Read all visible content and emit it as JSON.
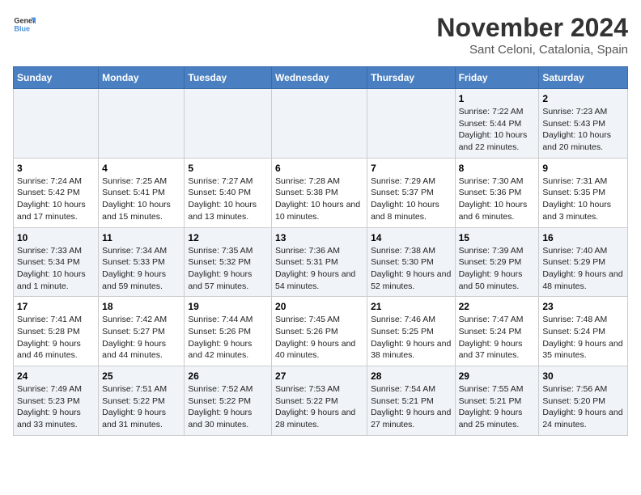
{
  "logo": {
    "general": "General",
    "blue": "Blue"
  },
  "title": "November 2024",
  "subtitle": "Sant Celoni, Catalonia, Spain",
  "headers": [
    "Sunday",
    "Monday",
    "Tuesday",
    "Wednesday",
    "Thursday",
    "Friday",
    "Saturday"
  ],
  "rows": [
    [
      {
        "day": "",
        "info": ""
      },
      {
        "day": "",
        "info": ""
      },
      {
        "day": "",
        "info": ""
      },
      {
        "day": "",
        "info": ""
      },
      {
        "day": "",
        "info": ""
      },
      {
        "day": "1",
        "info": "Sunrise: 7:22 AM\nSunset: 5:44 PM\nDaylight: 10 hours and 22 minutes."
      },
      {
        "day": "2",
        "info": "Sunrise: 7:23 AM\nSunset: 5:43 PM\nDaylight: 10 hours and 20 minutes."
      }
    ],
    [
      {
        "day": "3",
        "info": "Sunrise: 7:24 AM\nSunset: 5:42 PM\nDaylight: 10 hours and 17 minutes."
      },
      {
        "day": "4",
        "info": "Sunrise: 7:25 AM\nSunset: 5:41 PM\nDaylight: 10 hours and 15 minutes."
      },
      {
        "day": "5",
        "info": "Sunrise: 7:27 AM\nSunset: 5:40 PM\nDaylight: 10 hours and 13 minutes."
      },
      {
        "day": "6",
        "info": "Sunrise: 7:28 AM\nSunset: 5:38 PM\nDaylight: 10 hours and 10 minutes."
      },
      {
        "day": "7",
        "info": "Sunrise: 7:29 AM\nSunset: 5:37 PM\nDaylight: 10 hours and 8 minutes."
      },
      {
        "day": "8",
        "info": "Sunrise: 7:30 AM\nSunset: 5:36 PM\nDaylight: 10 hours and 6 minutes."
      },
      {
        "day": "9",
        "info": "Sunrise: 7:31 AM\nSunset: 5:35 PM\nDaylight: 10 hours and 3 minutes."
      }
    ],
    [
      {
        "day": "10",
        "info": "Sunrise: 7:33 AM\nSunset: 5:34 PM\nDaylight: 10 hours and 1 minute."
      },
      {
        "day": "11",
        "info": "Sunrise: 7:34 AM\nSunset: 5:33 PM\nDaylight: 9 hours and 59 minutes."
      },
      {
        "day": "12",
        "info": "Sunrise: 7:35 AM\nSunset: 5:32 PM\nDaylight: 9 hours and 57 minutes."
      },
      {
        "day": "13",
        "info": "Sunrise: 7:36 AM\nSunset: 5:31 PM\nDaylight: 9 hours and 54 minutes."
      },
      {
        "day": "14",
        "info": "Sunrise: 7:38 AM\nSunset: 5:30 PM\nDaylight: 9 hours and 52 minutes."
      },
      {
        "day": "15",
        "info": "Sunrise: 7:39 AM\nSunset: 5:29 PM\nDaylight: 9 hours and 50 minutes."
      },
      {
        "day": "16",
        "info": "Sunrise: 7:40 AM\nSunset: 5:29 PM\nDaylight: 9 hours and 48 minutes."
      }
    ],
    [
      {
        "day": "17",
        "info": "Sunrise: 7:41 AM\nSunset: 5:28 PM\nDaylight: 9 hours and 46 minutes."
      },
      {
        "day": "18",
        "info": "Sunrise: 7:42 AM\nSunset: 5:27 PM\nDaylight: 9 hours and 44 minutes."
      },
      {
        "day": "19",
        "info": "Sunrise: 7:44 AM\nSunset: 5:26 PM\nDaylight: 9 hours and 42 minutes."
      },
      {
        "day": "20",
        "info": "Sunrise: 7:45 AM\nSunset: 5:26 PM\nDaylight: 9 hours and 40 minutes."
      },
      {
        "day": "21",
        "info": "Sunrise: 7:46 AM\nSunset: 5:25 PM\nDaylight: 9 hours and 38 minutes."
      },
      {
        "day": "22",
        "info": "Sunrise: 7:47 AM\nSunset: 5:24 PM\nDaylight: 9 hours and 37 minutes."
      },
      {
        "day": "23",
        "info": "Sunrise: 7:48 AM\nSunset: 5:24 PM\nDaylight: 9 hours and 35 minutes."
      }
    ],
    [
      {
        "day": "24",
        "info": "Sunrise: 7:49 AM\nSunset: 5:23 PM\nDaylight: 9 hours and 33 minutes."
      },
      {
        "day": "25",
        "info": "Sunrise: 7:51 AM\nSunset: 5:22 PM\nDaylight: 9 hours and 31 minutes."
      },
      {
        "day": "26",
        "info": "Sunrise: 7:52 AM\nSunset: 5:22 PM\nDaylight: 9 hours and 30 minutes."
      },
      {
        "day": "27",
        "info": "Sunrise: 7:53 AM\nSunset: 5:22 PM\nDaylight: 9 hours and 28 minutes."
      },
      {
        "day": "28",
        "info": "Sunrise: 7:54 AM\nSunset: 5:21 PM\nDaylight: 9 hours and 27 minutes."
      },
      {
        "day": "29",
        "info": "Sunrise: 7:55 AM\nSunset: 5:21 PM\nDaylight: 9 hours and 25 minutes."
      },
      {
        "day": "30",
        "info": "Sunrise: 7:56 AM\nSunset: 5:20 PM\nDaylight: 9 hours and 24 minutes."
      }
    ]
  ]
}
